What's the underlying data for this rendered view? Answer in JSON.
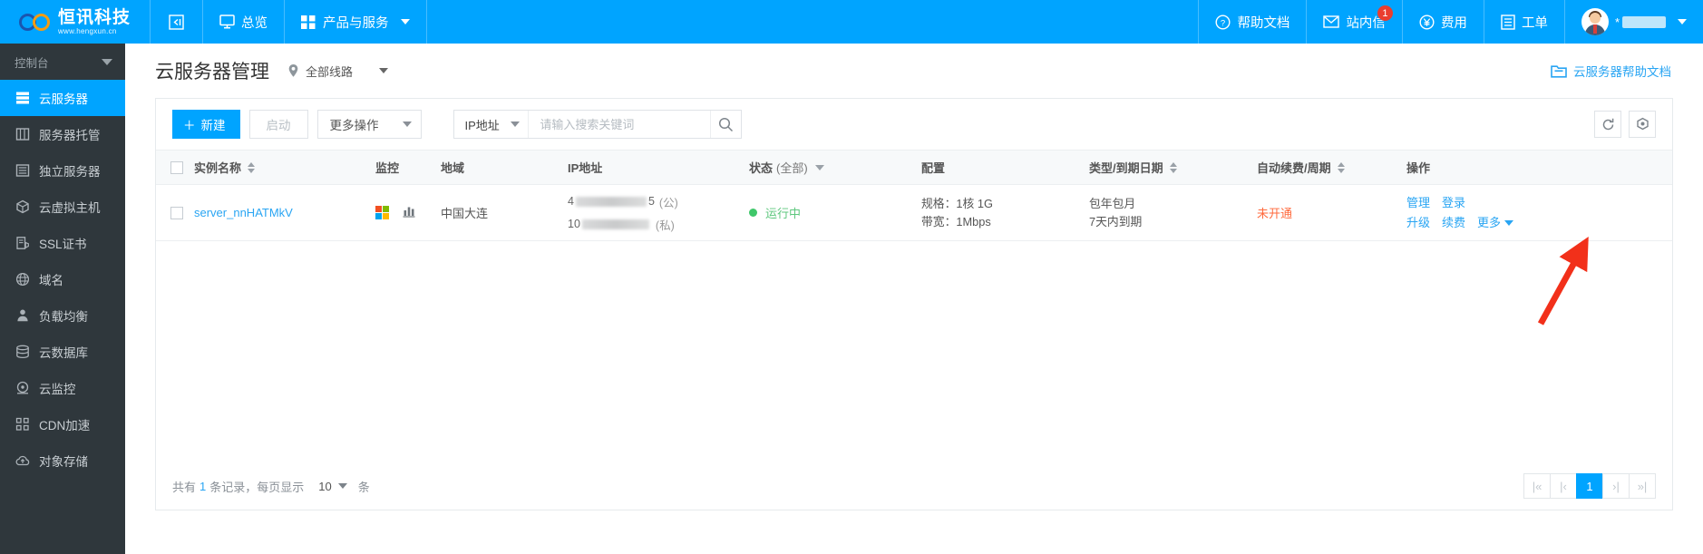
{
  "topnav": {
    "logo": {
      "name_cn": "恒讯科技",
      "url": "www.hengxun.cn"
    },
    "collapse_icon": "collapse-icon",
    "items": [
      {
        "label": "总览",
        "icon": "monitor-icon",
        "has_caret": false
      },
      {
        "label": "产品与服务",
        "icon": "grid-icon",
        "has_caret": true
      }
    ],
    "right_items": [
      {
        "label": "帮助文档",
        "icon": "question-circle-icon",
        "badge": ""
      },
      {
        "label": "站内信",
        "icon": "envelope-icon",
        "badge": "1"
      },
      {
        "label": "费用",
        "icon": "yen-circle-icon",
        "badge": ""
      },
      {
        "label": "工单",
        "icon": "ticket-icon",
        "badge": ""
      }
    ],
    "user": {
      "name_prefix": "*",
      "name_redacted": true,
      "avatar": "user-avatar"
    }
  },
  "sidebar": {
    "console_label": "控制台",
    "items": [
      {
        "label": "云服务器",
        "icon": "server-icon",
        "active": true
      },
      {
        "label": "服务器托管",
        "icon": "rack-icon",
        "active": false
      },
      {
        "label": "独立服务器",
        "icon": "list-server-icon",
        "active": false
      },
      {
        "label": "云虚拟主机",
        "icon": "cube-icon",
        "active": false
      },
      {
        "label": "SSL证书",
        "icon": "certificate-icon",
        "active": false
      },
      {
        "label": "域名",
        "icon": "globe-icon",
        "active": false
      },
      {
        "label": "负载均衡",
        "icon": "balance-icon",
        "active": false
      },
      {
        "label": "云数据库",
        "icon": "database-icon",
        "active": false
      },
      {
        "label": "云监控",
        "icon": "gauge-icon",
        "active": false
      },
      {
        "label": "CDN加速",
        "icon": "cdn-grid-icon",
        "active": false
      },
      {
        "label": "对象存储",
        "icon": "cloud-upload-icon",
        "active": false
      }
    ]
  },
  "page": {
    "title": "云服务器管理",
    "region": "全部线路",
    "region_icon": "location-pin-icon",
    "help_link": "云服务器帮助文档",
    "help_icon": "folder-icon"
  },
  "toolbar": {
    "new_label": "新建",
    "start_label": "启动",
    "more_actions_label": "更多操作",
    "search_type": "IP地址",
    "search_placeholder": "请输入搜索关键词",
    "search_value": "",
    "search_icon": "search-icon",
    "refresh_icon": "refresh-icon",
    "settings_icon": "gear-hex-icon"
  },
  "table": {
    "columns": [
      {
        "key": "checkbox",
        "label": "",
        "sortable": false,
        "filter": false
      },
      {
        "key": "name",
        "label": "实例名称",
        "sortable": true,
        "filter": false
      },
      {
        "key": "monitor",
        "label": "监控",
        "sortable": false,
        "filter": false
      },
      {
        "key": "region",
        "label": "地域",
        "sortable": false,
        "filter": false
      },
      {
        "key": "ip",
        "label": "IP地址",
        "sortable": false,
        "filter": false
      },
      {
        "key": "status",
        "label": "状态",
        "sub": "(全部)",
        "sortable": false,
        "filter": true
      },
      {
        "key": "config",
        "label": "配置",
        "sortable": false,
        "filter": false
      },
      {
        "key": "type",
        "label": "类型/到期日期",
        "sortable": true,
        "filter": false
      },
      {
        "key": "renew",
        "label": "自动续费/周期",
        "sortable": true,
        "filter": false
      },
      {
        "key": "actions",
        "label": "操作",
        "sortable": false,
        "filter": false
      }
    ],
    "rows": [
      {
        "name": "server_nnHATMkV",
        "os_icon": "windows-logo-icon",
        "monitor_icon": "bar-chart-icon",
        "region": "中国大连",
        "ip_public_prefix": "4",
        "ip_public_suffix": "5",
        "ip_public_tag": "(公)",
        "ip_private_prefix": "10",
        "ip_private_suffix": "",
        "ip_private_tag": "(私)",
        "status": "运行中",
        "status_color": "#5ec77e",
        "config_spec": "规格：1核 1G",
        "config_bandwidth": "带宽：1Mbps",
        "type": "包年包月",
        "expiry": "7天内到期",
        "expiry_color": "#ff3b30",
        "renew": "未开通",
        "renew_color": "#ff6a3d",
        "actions": [
          "管理",
          "登录",
          "升级",
          "续费",
          "更多"
        ]
      }
    ]
  },
  "footer": {
    "total_prefix": "共有",
    "total_count": "1",
    "total_suffix": "条记录，每页显示",
    "page_size": "10",
    "unit": "条",
    "pager": [
      {
        "label": "|«",
        "active": false,
        "name": "first-page"
      },
      {
        "label": "|‹",
        "active": false,
        "name": "prev-page"
      },
      {
        "label": "1",
        "active": true,
        "name": "page-1"
      },
      {
        "label": "›|",
        "active": false,
        "name": "next-page"
      },
      {
        "label": "»|",
        "active": false,
        "name": "last-page"
      }
    ]
  },
  "annotation": {
    "arrow_color": "#f2301a",
    "points_at": "续费"
  },
  "colors": {
    "brand": "#00a4ff",
    "sidebar_bg": "#2f373c",
    "link": "#29a5f3"
  }
}
